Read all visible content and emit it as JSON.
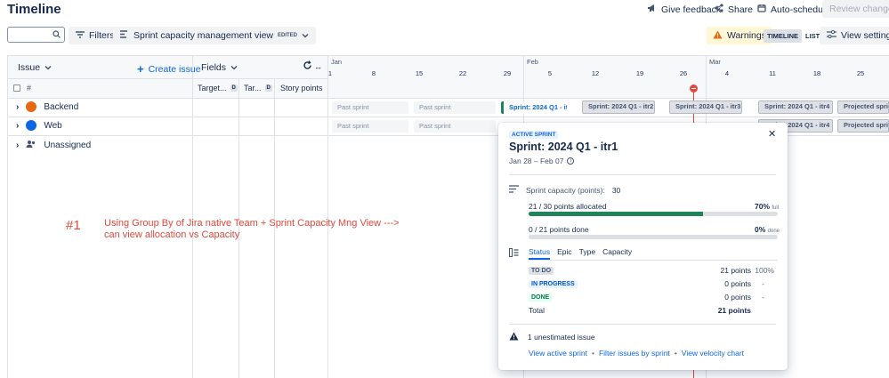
{
  "header": {
    "title": "Timeline",
    "give_feedback": "Give feedback",
    "share": "Share",
    "auto_schedule": "Auto-schedule",
    "review_changes": "Review changes"
  },
  "toolbar": {
    "search_placeholder": "",
    "filters": "Filters",
    "view_name": "Sprint capacity management view",
    "view_badge": "EDITED",
    "warnings": "Warnings",
    "toggle_timeline": "TIMELINE",
    "toggle_list": "LIST",
    "view_settings": "View settings"
  },
  "table": {
    "issue_header": "Issue",
    "create_issue": "Create issue",
    "fields": "Fields",
    "hash": "#",
    "columns": [
      {
        "label": "Target...",
        "badge": "D"
      },
      {
        "label": "Tar...",
        "badge": "D"
      },
      {
        "label": "Story points"
      }
    ],
    "rows": [
      {
        "label": "Backend"
      },
      {
        "label": "Web"
      },
      {
        "label": "Unassigned"
      }
    ]
  },
  "timeline": {
    "months": [
      "Jan",
      "Feb",
      "Mar"
    ],
    "ticks": [
      "1",
      "8",
      "15",
      "22",
      "29",
      "5",
      "12",
      "19",
      "26",
      "4",
      "11",
      "18",
      "25"
    ],
    "row1": {
      "past1": "Past sprint",
      "past2": "Past sprint",
      "active": "Sprint: 2024 Q1 - itr1",
      "itr2": "Sprint: 2024 Q1 - itr2",
      "itr3": "Sprint: 2024 Q1 - itr3",
      "itr4": "Sprint: 2024 Q1 - itr4",
      "projected": "Projected sprint"
    },
    "row2": {
      "past1": "Past sprint",
      "past2": "Past sprint",
      "itr4": "Sprint: 2024 Q1 - itr4",
      "projected": "Projected sprint"
    }
  },
  "popup": {
    "badge": "ACTIVE SPRINT",
    "title": "Sprint: 2024 Q1 - itr1",
    "dates": "Jan 28 – Feb 07",
    "capacity_label": "Sprint capacity (points):",
    "capacity_value": "30",
    "allocated_text": "21 / 30 points allocated",
    "allocated_pct": "70%",
    "allocated_suffix": "full",
    "allocated_fraction": 0.7,
    "done_text": "0 / 21 points done",
    "done_pct": "0%",
    "done_suffix": "done",
    "done_fraction": 0.0,
    "tabs": [
      "Status",
      "Epic",
      "Type",
      "Capacity"
    ],
    "statuses": [
      {
        "name": "TO DO",
        "points": "21 points",
        "pct": "100%"
      },
      {
        "name": "IN PROGRESS",
        "points": "0 points",
        "pct": "-"
      },
      {
        "name": "DONE",
        "points": "0 points",
        "pct": "-"
      }
    ],
    "total_label": "Total",
    "total_points": "21 points",
    "unestimated": "1 unestimated issue",
    "links": [
      "View active sprint",
      "Filter issues by sprint",
      "View velocity chart"
    ]
  },
  "annotation": {
    "marker": "#1",
    "line1": "Using Group By of Jira native Team + Sprint Capacity Mng View --->",
    "line2": "can view allocation vs Capacity"
  },
  "colors": {
    "accent": "#0c66e4",
    "progress": "#1f845a",
    "today": "#e2483d",
    "annotation": "#e2483d"
  }
}
